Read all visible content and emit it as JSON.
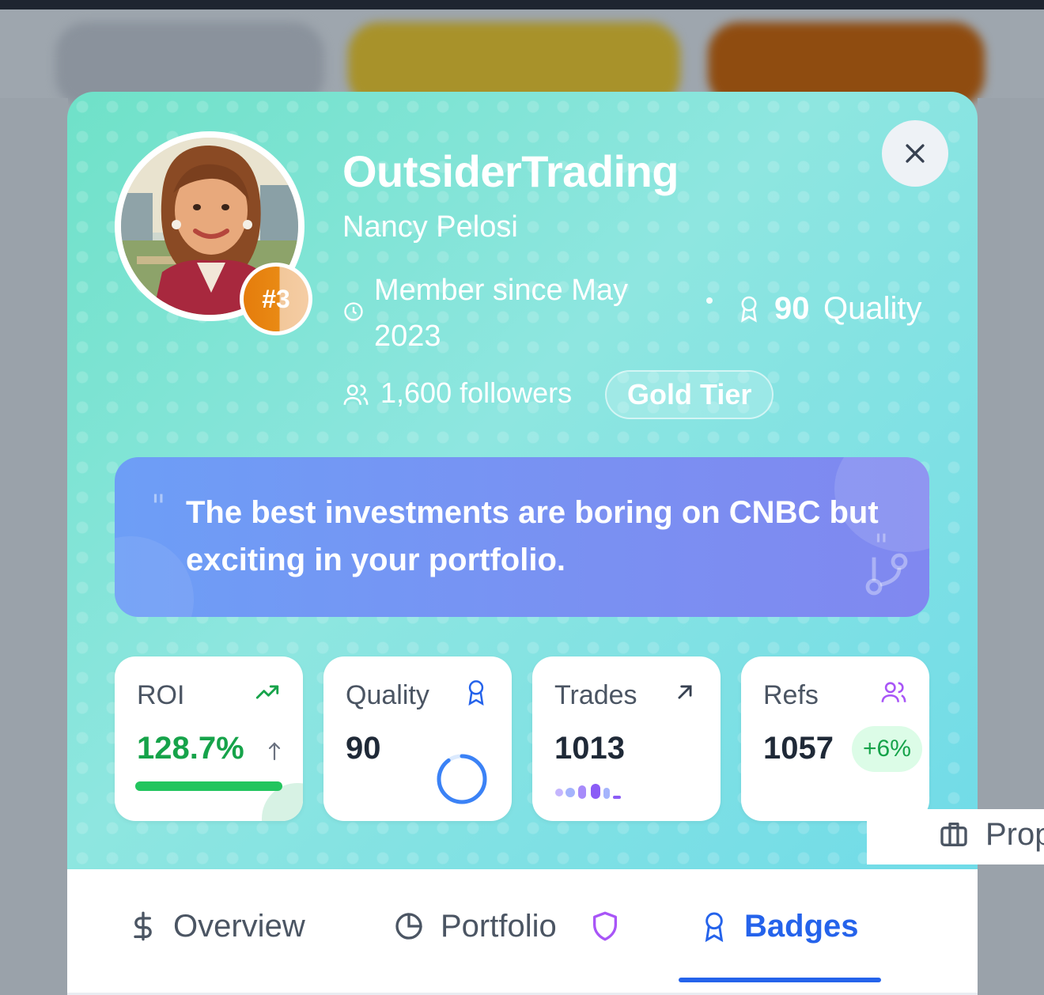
{
  "profile": {
    "username": "OutsiderTrading",
    "real_name": "Nancy Pelosi",
    "rank": "#3",
    "member_since": "Member since May 2023",
    "quality_value": "90",
    "quality_label": "Quality",
    "followers": "1,600 followers",
    "tier": "Gold Tier"
  },
  "quote": {
    "open_mark": "\"",
    "text": "The best investments are boring on CNBC but exciting in your portfolio.",
    "close_mark": "\""
  },
  "stats": [
    {
      "label": "ROI",
      "value": "128.7%",
      "progress": 1.0,
      "icon": "trending-up-icon"
    },
    {
      "label": "Quality",
      "value": "90",
      "progress": 0.9,
      "icon": "award-icon"
    },
    {
      "label": "Trades",
      "value": "1013",
      "icon": "arrow-up-right-icon"
    },
    {
      "label": "Refs",
      "value": "1057",
      "change": "+6%",
      "icon": "users-icon"
    }
  ],
  "tabs": [
    {
      "label": "Overview",
      "icon": "dollar-icon"
    },
    {
      "label": "Portfolio",
      "icon": "pie-chart-icon",
      "extra_icon": "shield-icon"
    },
    {
      "label": "Badges",
      "icon": "award-icon",
      "active": true
    },
    {
      "label": "Prop",
      "icon": "briefcase-icon"
    }
  ],
  "colors": {
    "accent": "#2563eb",
    "positive": "#16a34a",
    "hero_gradient_start": "#6fe1c8",
    "hero_gradient_end": "#70dbe8",
    "rank_badge": "#e98a14"
  }
}
